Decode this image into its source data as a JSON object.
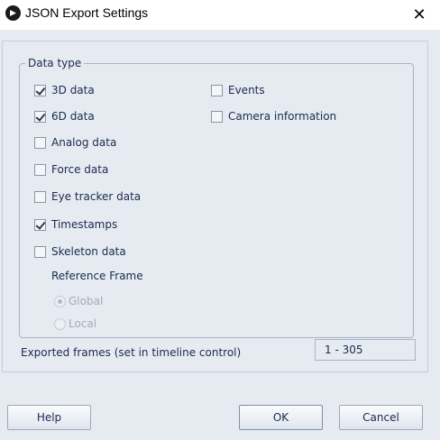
{
  "window": {
    "title": "JSON Export Settings",
    "icon": "app-logo-icon",
    "close_glyph": "✕"
  },
  "data_type": {
    "legend": "Data type",
    "left_options": [
      {
        "label": "3D data",
        "checked": true
      },
      {
        "label": "6D data",
        "checked": true
      },
      {
        "label": "Analog data",
        "checked": false
      },
      {
        "label": "Force data",
        "checked": false
      },
      {
        "label": "Eye tracker data",
        "checked": false
      },
      {
        "label": "Timestamps",
        "checked": true
      },
      {
        "label": "Skeleton data",
        "checked": false
      }
    ],
    "right_options": [
      {
        "label": "Events",
        "checked": false
      },
      {
        "label": "Camera information",
        "checked": false
      }
    ],
    "reference_frame": {
      "label": "Reference Frame",
      "options": [
        {
          "label": "Global",
          "selected": true,
          "enabled": false
        },
        {
          "label": "Local",
          "selected": false,
          "enabled": false
        }
      ]
    }
  },
  "frames": {
    "label": "Exported frames (set in timeline control)",
    "value": "1 - 305"
  },
  "buttons": {
    "help": "Help",
    "ok": "OK",
    "cancel": "Cancel"
  }
}
